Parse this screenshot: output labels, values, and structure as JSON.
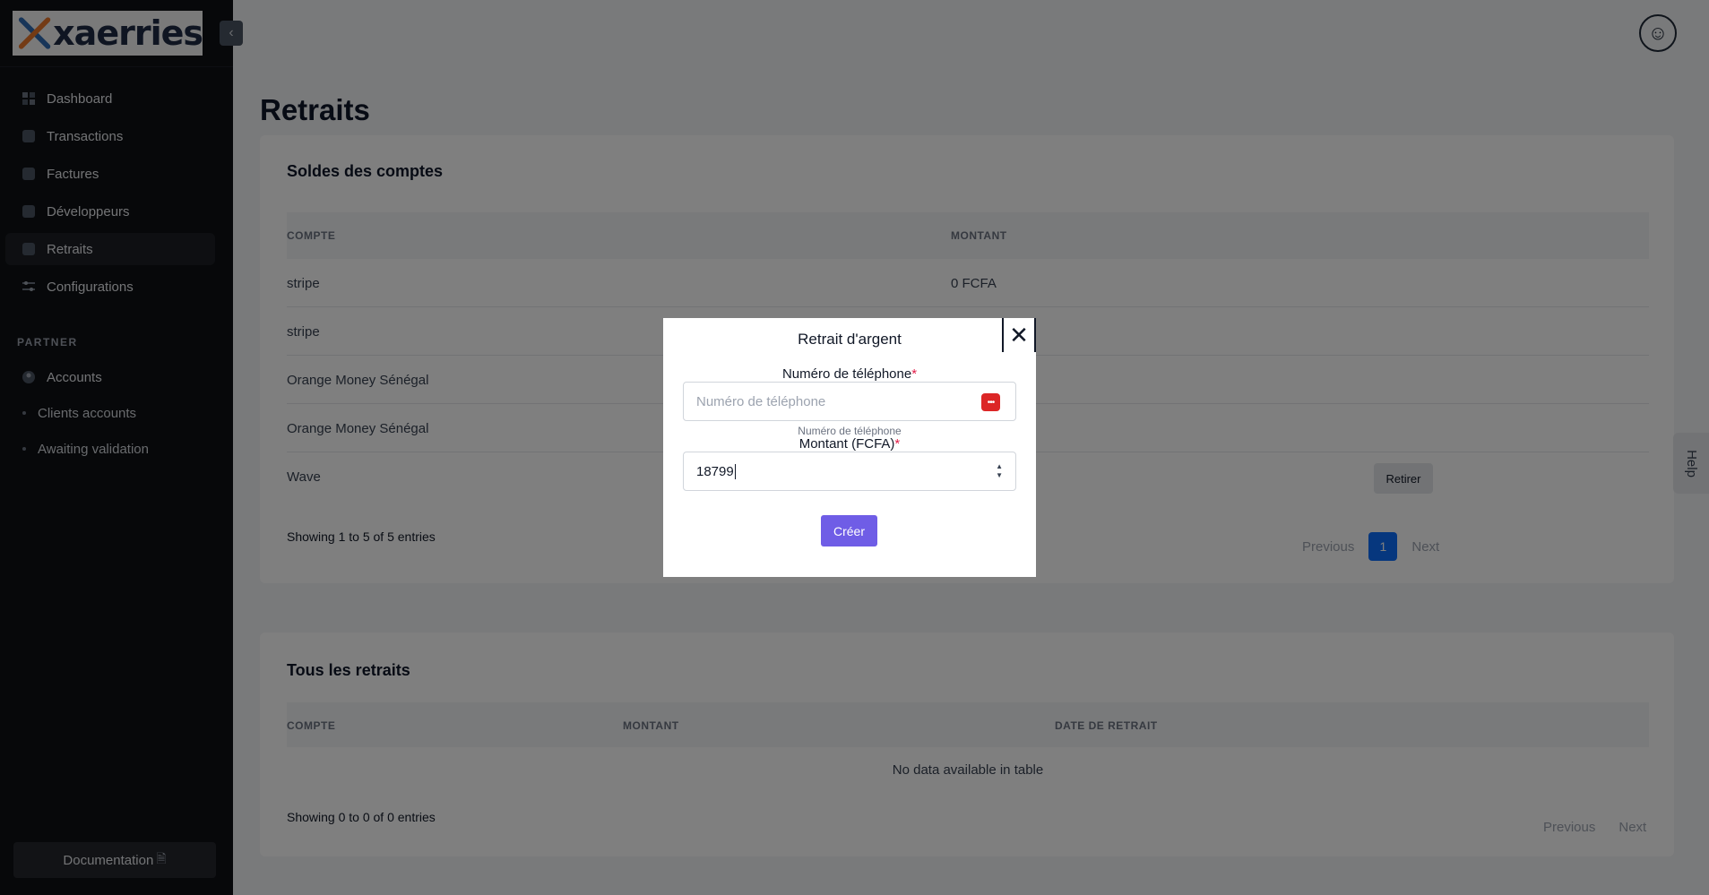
{
  "brand": {
    "name": "xaerries"
  },
  "sidebar": {
    "items": [
      {
        "label": "Dashboard",
        "icon": "dashboard-icon"
      },
      {
        "label": "Transactions",
        "icon": "percent-icon"
      },
      {
        "label": "Factures",
        "icon": "receipt-icon"
      },
      {
        "label": "Développeurs",
        "icon": "terminal-icon"
      },
      {
        "label": "Retraits",
        "icon": "withdraw-icon",
        "active": true
      },
      {
        "label": "Configurations",
        "icon": "sliders-icon"
      }
    ],
    "section_label": "PARTNER",
    "partner_items": [
      {
        "label": "Accounts",
        "icon": "user-icon"
      },
      {
        "label": "Clients accounts"
      },
      {
        "label": "Awaiting validation"
      }
    ],
    "documentation_label": "Documentation"
  },
  "page": {
    "title": "Retraits"
  },
  "balances": {
    "title": "Soldes des comptes",
    "columns": [
      "COMPTE",
      "MONTANT"
    ],
    "rows": [
      {
        "compte": "stripe",
        "montant": "0 FCFA"
      },
      {
        "compte": "stripe",
        "montant": ""
      },
      {
        "compte": "Orange Money Sénégal",
        "montant": ""
      },
      {
        "compte": "Orange Money Sénégal",
        "montant": ""
      },
      {
        "compte": "Wave",
        "montant": ""
      }
    ],
    "action_label": "Retirer",
    "info": "Showing 1 to 5 of 5 entries",
    "pager": {
      "previous": "Previous",
      "current": "1",
      "next": "Next"
    }
  },
  "withdrawals": {
    "title": "Tous les retraits",
    "columns": [
      "COMPTE",
      "MONTANT",
      "DATE DE RETRAIT"
    ],
    "empty": "No data available in table",
    "info": "Showing 0 to 0 of 0 entries",
    "pager": {
      "previous": "Previous",
      "next": "Next"
    }
  },
  "help": {
    "label": "Help"
  },
  "modal": {
    "title": "Retrait d'argent",
    "phone_label": "Numéro de téléphone",
    "phone_placeholder": "Numéro de téléphone",
    "phone_value": "",
    "phone_hint": "Numéro de téléphone",
    "amount_label": "Montant (FCFA)",
    "amount_value": "18799",
    "required_mark": "*",
    "submit_label": "Créer"
  },
  "colors": {
    "accent": "#6f5de6",
    "pager_active": "#0d6efd",
    "sidebar_bg": "#0f1115"
  }
}
